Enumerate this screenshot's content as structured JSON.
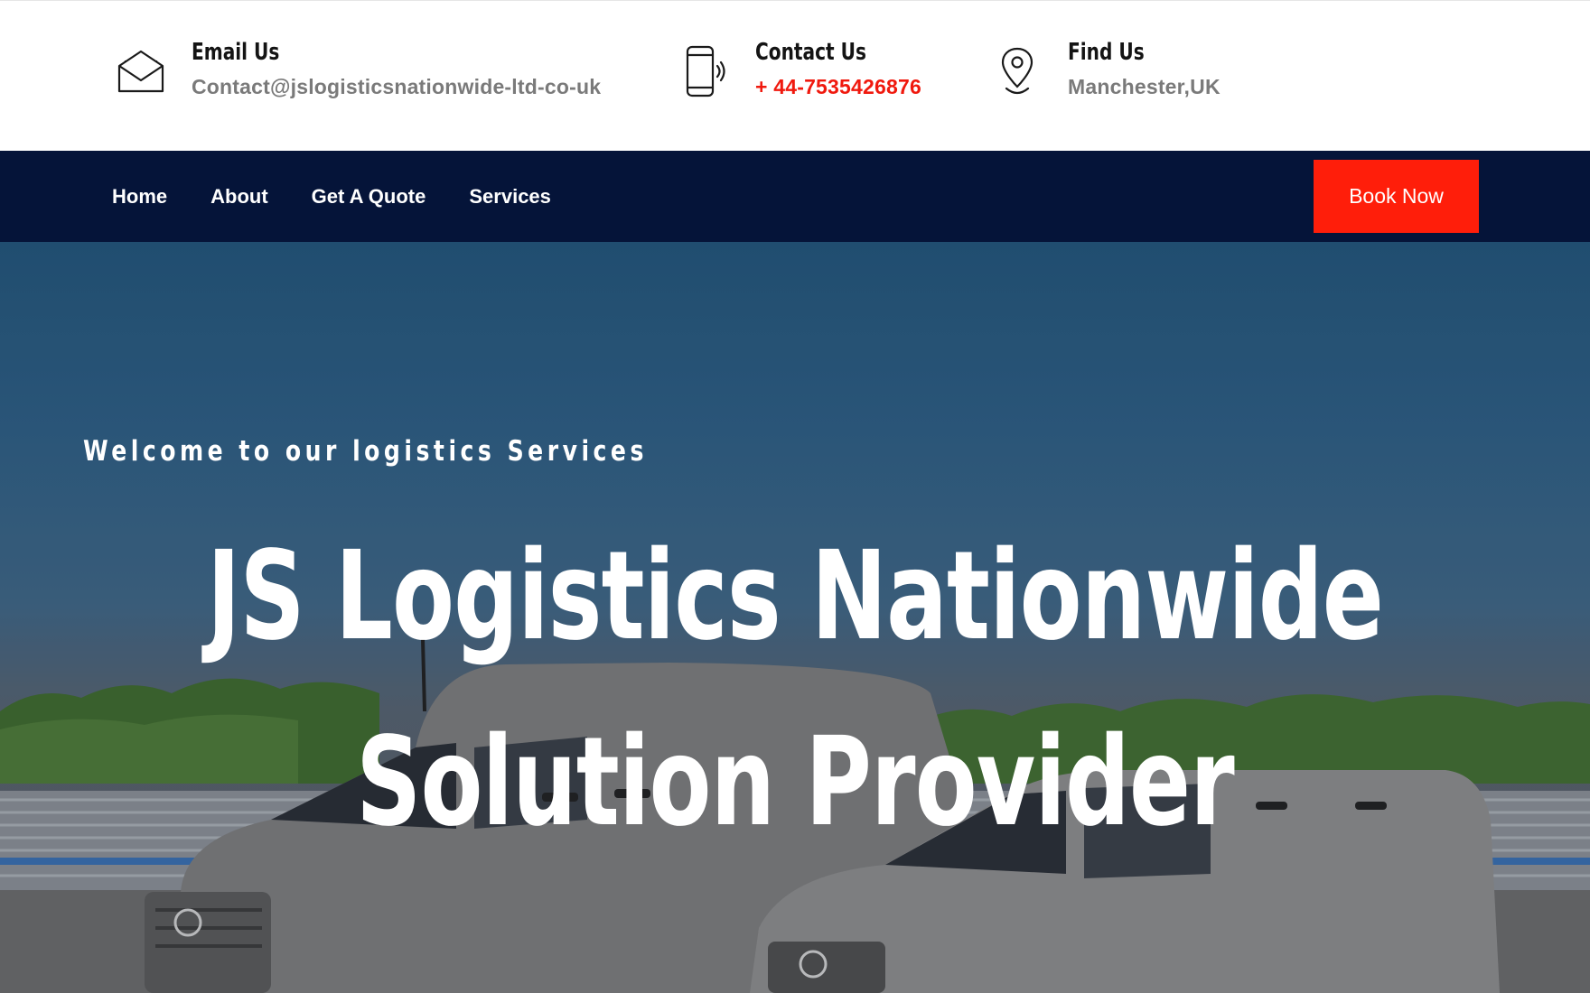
{
  "contacts": [
    {
      "label": "Email Us",
      "value": "Contact@jslogisticsnationwide-ltd-co-uk",
      "icon": "envelope-icon"
    },
    {
      "label": "Contact Us",
      "value": "+ 44-7535426876",
      "icon": "phone-icon",
      "color": "#f0190e"
    },
    {
      "label": "Find Us",
      "value": "Manchester,UK",
      "icon": "location-pin-icon"
    }
  ],
  "nav": {
    "items": [
      "Home",
      "About",
      "Get A Quote",
      "Services"
    ],
    "cta": "Book Now"
  },
  "hero": {
    "kicker": "Welcome to our logistics Services",
    "title_line1": "JS Logistics Nationwide",
    "title_line2": "Solution Provider",
    "image": "two grey delivery vans parked on a road under blue sky"
  },
  "colors": {
    "nav_bg": "#051439",
    "accent": "#ff1e0a",
    "muted_text": "#7a7a7a"
  }
}
